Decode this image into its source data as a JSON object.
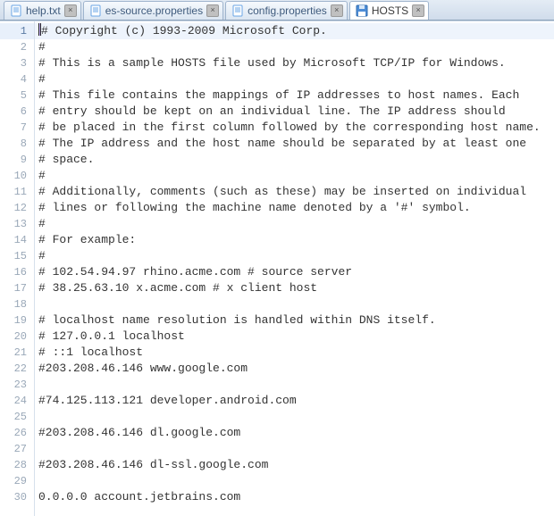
{
  "tabs": [
    {
      "label": "help.txt",
      "active": false,
      "icon": "file",
      "color": "#6aa5e6"
    },
    {
      "label": "es-source.properties",
      "active": false,
      "icon": "file",
      "color": "#6aa5e6"
    },
    {
      "label": "config.properties",
      "active": false,
      "icon": "file",
      "color": "#6aa5e6"
    },
    {
      "label": "HOSTS",
      "active": true,
      "icon": "disk",
      "color": "#4e8dd6"
    }
  ],
  "cursor_line": 1,
  "lines": [
    "# Copyright (c) 1993-2009 Microsoft Corp.",
    "#",
    "# This is a sample HOSTS file used by Microsoft TCP/IP for Windows.",
    "#",
    "# This file contains the mappings of IP addresses to host names. Each",
    "# entry should be kept on an individual line. The IP address should",
    "# be placed in the first column followed by the corresponding host name.",
    "# The IP address and the host name should be separated by at least one",
    "# space.",
    "#",
    "# Additionally, comments (such as these) may be inserted on individual",
    "# lines or following the machine name denoted by a '#' symbol.",
    "#",
    "# For example:",
    "#",
    "# 102.54.94.97 rhino.acme.com # source server",
    "# 38.25.63.10 x.acme.com # x client host",
    "",
    "# localhost name resolution is handled within DNS itself.",
    "# 127.0.0.1 localhost",
    "# ::1 localhost",
    "#203.208.46.146 www.google.com",
    "",
    "#74.125.113.121 developer.android.com",
    "",
    "#203.208.46.146 dl.google.com",
    "",
    "#203.208.46.146 dl-ssl.google.com",
    "",
    "0.0.0.0 account.jetbrains.com"
  ]
}
